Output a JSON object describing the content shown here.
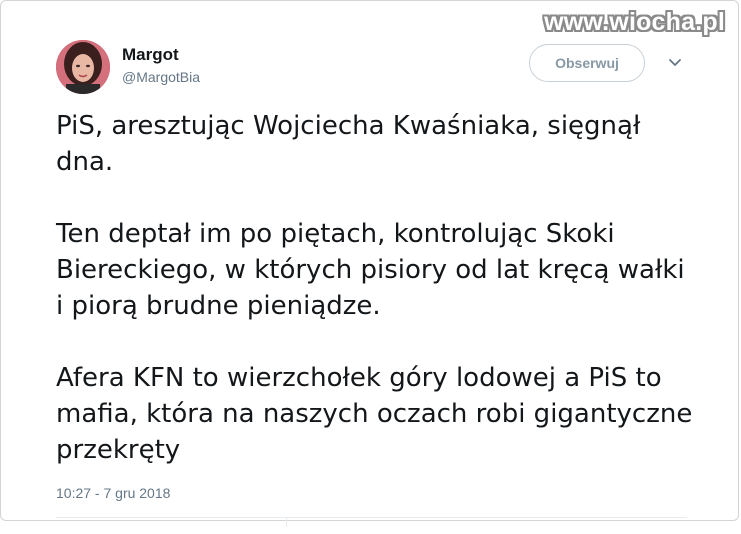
{
  "watermark": "www.wiocha.pl",
  "tweet": {
    "author_name": "Margot",
    "author_handle": "@MargotBia",
    "follow_label": "Obserwuj",
    "paragraphs": [
      "PiS, aresztując Wojciecha Kwaśniaka, sięgnął dna.",
      "Ten deptał im po piętach, kontrolując Skoki Biereckiego, w których pisiory od lat kręcą wałki i piorą brudne pieniądze.",
      "Afera KFN to wierzchołek góry lodowej a PiS to mafia, która na naszych oczach robi gigantyczne przekręty"
    ],
    "timestamp": "10:27 - 7 gru 2018"
  },
  "icons": {
    "avatar": "avatar-photo",
    "more": "chevron-down-icon"
  },
  "colors": {
    "text": "#14171a",
    "secondary": "#657786",
    "button_text": "#8899a6",
    "border": "#c8d0d6"
  }
}
